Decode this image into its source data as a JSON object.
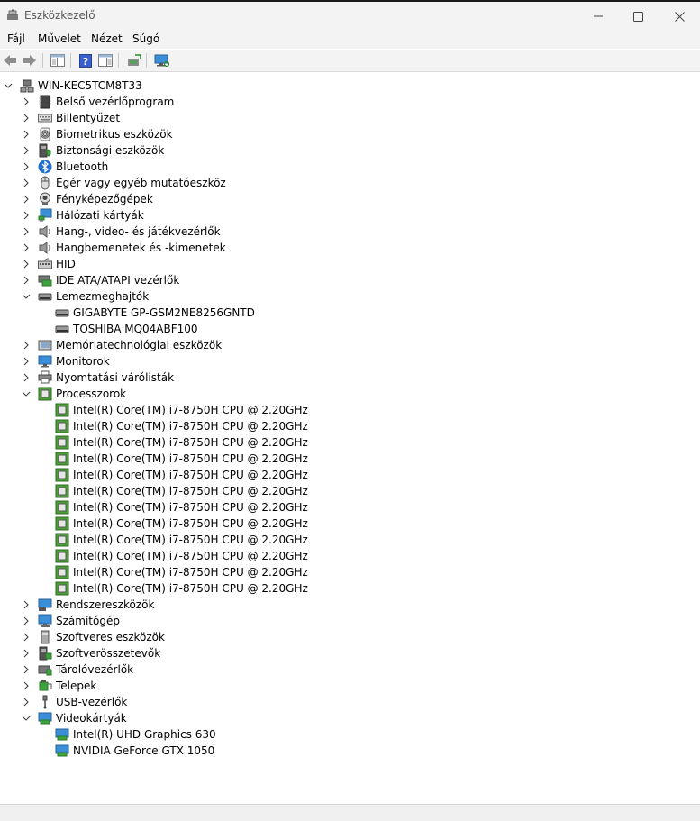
{
  "window": {
    "title": "Eszközkezelő"
  },
  "menu": {
    "items": [
      "Fájl",
      "Művelet",
      "Nézet",
      "Súgó"
    ]
  },
  "tree": {
    "root": "WIN-KEC5TCM8T33",
    "categories": [
      {
        "label": "Belső vezérlőprogram",
        "icon": "firmware-icon",
        "expanded": false
      },
      {
        "label": "Billentyűzet",
        "icon": "keyboard-icon",
        "expanded": false
      },
      {
        "label": "Biometrikus eszközök",
        "icon": "fingerprint-icon",
        "expanded": false
      },
      {
        "label": "Biztonsági eszközök",
        "icon": "security-device-icon",
        "expanded": false
      },
      {
        "label": "Bluetooth",
        "icon": "bluetooth-icon",
        "expanded": false
      },
      {
        "label": "Egér vagy egyéb mutatóeszköz",
        "icon": "mouse-icon",
        "expanded": false
      },
      {
        "label": "Fényképezőgépek",
        "icon": "camera-icon",
        "expanded": false
      },
      {
        "label": "Hálózati kártyák",
        "icon": "network-adapter-icon",
        "expanded": false
      },
      {
        "label": "Hang-, video- és játékvezérlők",
        "icon": "speaker-icon",
        "expanded": false
      },
      {
        "label": "Hangbemenetek és -kimenetek",
        "icon": "speaker-icon",
        "expanded": false
      },
      {
        "label": "HID",
        "icon": "hid-icon",
        "expanded": false
      },
      {
        "label": "IDE ATA/ATAPI vezérlők",
        "icon": "ide-controller-icon",
        "expanded": false
      },
      {
        "label": "Lemezmeghajtók",
        "icon": "disk-drive-icon",
        "expanded": true,
        "children": [
          {
            "label": "GIGABYTE GP-GSM2NE8256GNTD",
            "icon": "disk-drive-icon"
          },
          {
            "label": "TOSHIBA MQ04ABF100",
            "icon": "disk-drive-icon"
          }
        ]
      },
      {
        "label": "Memóriatechnológiai eszközök",
        "icon": "memory-device-icon",
        "expanded": false
      },
      {
        "label": "Monitorok",
        "icon": "monitor-icon",
        "expanded": false
      },
      {
        "label": "Nyomtatási várólisták",
        "icon": "printer-icon",
        "expanded": false
      },
      {
        "label": "Processzorok",
        "icon": "processor-icon",
        "expanded": true,
        "children": [
          {
            "label": "Intel(R) Core(TM) i7-8750H CPU @ 2.20GHz",
            "icon": "processor-icon"
          },
          {
            "label": "Intel(R) Core(TM) i7-8750H CPU @ 2.20GHz",
            "icon": "processor-icon"
          },
          {
            "label": "Intel(R) Core(TM) i7-8750H CPU @ 2.20GHz",
            "icon": "processor-icon"
          },
          {
            "label": "Intel(R) Core(TM) i7-8750H CPU @ 2.20GHz",
            "icon": "processor-icon"
          },
          {
            "label": "Intel(R) Core(TM) i7-8750H CPU @ 2.20GHz",
            "icon": "processor-icon"
          },
          {
            "label": "Intel(R) Core(TM) i7-8750H CPU @ 2.20GHz",
            "icon": "processor-icon"
          },
          {
            "label": "Intel(R) Core(TM) i7-8750H CPU @ 2.20GHz",
            "icon": "processor-icon"
          },
          {
            "label": "Intel(R) Core(TM) i7-8750H CPU @ 2.20GHz",
            "icon": "processor-icon"
          },
          {
            "label": "Intel(R) Core(TM) i7-8750H CPU @ 2.20GHz",
            "icon": "processor-icon"
          },
          {
            "label": "Intel(R) Core(TM) i7-8750H CPU @ 2.20GHz",
            "icon": "processor-icon"
          },
          {
            "label": "Intel(R) Core(TM) i7-8750H CPU @ 2.20GHz",
            "icon": "processor-icon"
          },
          {
            "label": "Intel(R) Core(TM) i7-8750H CPU @ 2.20GHz",
            "icon": "processor-icon"
          }
        ]
      },
      {
        "label": "Rendszereszközök",
        "icon": "system-device-icon",
        "expanded": false
      },
      {
        "label": "Számítógép",
        "icon": "computer-icon",
        "expanded": false
      },
      {
        "label": "Szoftveres eszközök",
        "icon": "software-device-icon",
        "expanded": false
      },
      {
        "label": "Szoftverösszetevők",
        "icon": "software-component-icon",
        "expanded": false
      },
      {
        "label": "Tárolóvezérlők",
        "icon": "storage-controller-icon",
        "expanded": false
      },
      {
        "label": "Telepek",
        "icon": "battery-icon",
        "expanded": false
      },
      {
        "label": "USB-vezérlők",
        "icon": "usb-icon",
        "expanded": false
      },
      {
        "label": "Videokártyák",
        "icon": "display-adapter-icon",
        "expanded": true,
        "children": [
          {
            "label": "Intel(R) UHD Graphics 630",
            "icon": "display-adapter-icon"
          },
          {
            "label": "NVIDIA GeForce GTX 1050",
            "icon": "display-adapter-icon"
          }
        ]
      }
    ]
  }
}
